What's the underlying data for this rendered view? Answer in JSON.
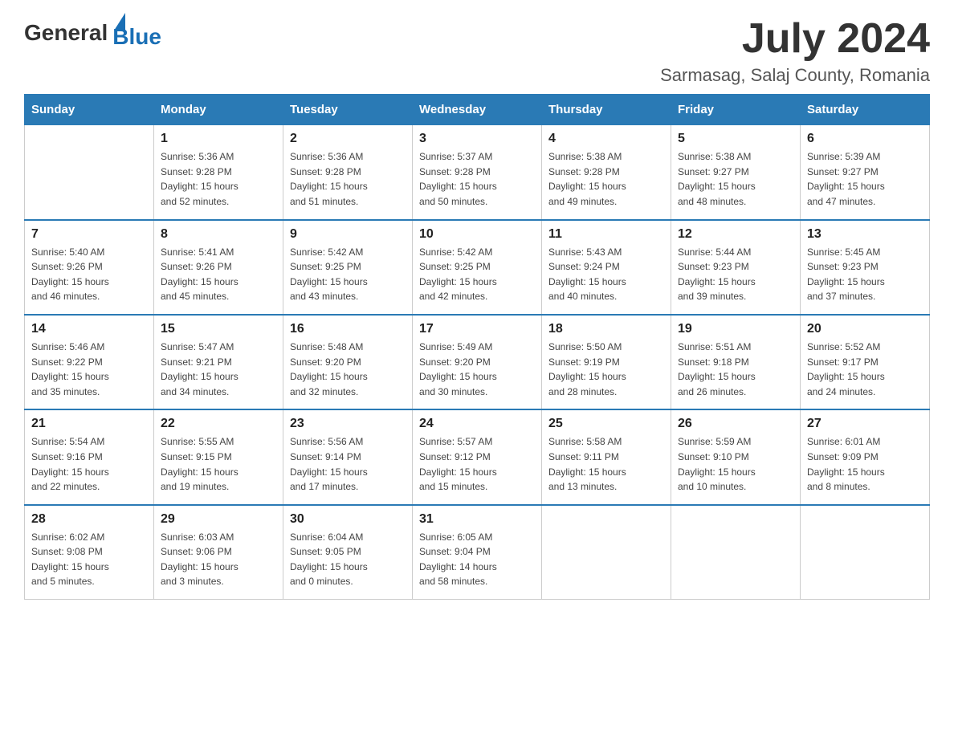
{
  "header": {
    "logo": {
      "text_general": "General",
      "text_blue": "Blue"
    },
    "month_title": "July 2024",
    "location": "Sarmasag, Salaj County, Romania"
  },
  "calendar": {
    "days_of_week": [
      "Sunday",
      "Monday",
      "Tuesday",
      "Wednesday",
      "Thursday",
      "Friday",
      "Saturday"
    ],
    "weeks": [
      [
        {
          "day": "",
          "info": ""
        },
        {
          "day": "1",
          "info": "Sunrise: 5:36 AM\nSunset: 9:28 PM\nDaylight: 15 hours\nand 52 minutes."
        },
        {
          "day": "2",
          "info": "Sunrise: 5:36 AM\nSunset: 9:28 PM\nDaylight: 15 hours\nand 51 minutes."
        },
        {
          "day": "3",
          "info": "Sunrise: 5:37 AM\nSunset: 9:28 PM\nDaylight: 15 hours\nand 50 minutes."
        },
        {
          "day": "4",
          "info": "Sunrise: 5:38 AM\nSunset: 9:28 PM\nDaylight: 15 hours\nand 49 minutes."
        },
        {
          "day": "5",
          "info": "Sunrise: 5:38 AM\nSunset: 9:27 PM\nDaylight: 15 hours\nand 48 minutes."
        },
        {
          "day": "6",
          "info": "Sunrise: 5:39 AM\nSunset: 9:27 PM\nDaylight: 15 hours\nand 47 minutes."
        }
      ],
      [
        {
          "day": "7",
          "info": "Sunrise: 5:40 AM\nSunset: 9:26 PM\nDaylight: 15 hours\nand 46 minutes."
        },
        {
          "day": "8",
          "info": "Sunrise: 5:41 AM\nSunset: 9:26 PM\nDaylight: 15 hours\nand 45 minutes."
        },
        {
          "day": "9",
          "info": "Sunrise: 5:42 AM\nSunset: 9:25 PM\nDaylight: 15 hours\nand 43 minutes."
        },
        {
          "day": "10",
          "info": "Sunrise: 5:42 AM\nSunset: 9:25 PM\nDaylight: 15 hours\nand 42 minutes."
        },
        {
          "day": "11",
          "info": "Sunrise: 5:43 AM\nSunset: 9:24 PM\nDaylight: 15 hours\nand 40 minutes."
        },
        {
          "day": "12",
          "info": "Sunrise: 5:44 AM\nSunset: 9:23 PM\nDaylight: 15 hours\nand 39 minutes."
        },
        {
          "day": "13",
          "info": "Sunrise: 5:45 AM\nSunset: 9:23 PM\nDaylight: 15 hours\nand 37 minutes."
        }
      ],
      [
        {
          "day": "14",
          "info": "Sunrise: 5:46 AM\nSunset: 9:22 PM\nDaylight: 15 hours\nand 35 minutes."
        },
        {
          "day": "15",
          "info": "Sunrise: 5:47 AM\nSunset: 9:21 PM\nDaylight: 15 hours\nand 34 minutes."
        },
        {
          "day": "16",
          "info": "Sunrise: 5:48 AM\nSunset: 9:20 PM\nDaylight: 15 hours\nand 32 minutes."
        },
        {
          "day": "17",
          "info": "Sunrise: 5:49 AM\nSunset: 9:20 PM\nDaylight: 15 hours\nand 30 minutes."
        },
        {
          "day": "18",
          "info": "Sunrise: 5:50 AM\nSunset: 9:19 PM\nDaylight: 15 hours\nand 28 minutes."
        },
        {
          "day": "19",
          "info": "Sunrise: 5:51 AM\nSunset: 9:18 PM\nDaylight: 15 hours\nand 26 minutes."
        },
        {
          "day": "20",
          "info": "Sunrise: 5:52 AM\nSunset: 9:17 PM\nDaylight: 15 hours\nand 24 minutes."
        }
      ],
      [
        {
          "day": "21",
          "info": "Sunrise: 5:54 AM\nSunset: 9:16 PM\nDaylight: 15 hours\nand 22 minutes."
        },
        {
          "day": "22",
          "info": "Sunrise: 5:55 AM\nSunset: 9:15 PM\nDaylight: 15 hours\nand 19 minutes."
        },
        {
          "day": "23",
          "info": "Sunrise: 5:56 AM\nSunset: 9:14 PM\nDaylight: 15 hours\nand 17 minutes."
        },
        {
          "day": "24",
          "info": "Sunrise: 5:57 AM\nSunset: 9:12 PM\nDaylight: 15 hours\nand 15 minutes."
        },
        {
          "day": "25",
          "info": "Sunrise: 5:58 AM\nSunset: 9:11 PM\nDaylight: 15 hours\nand 13 minutes."
        },
        {
          "day": "26",
          "info": "Sunrise: 5:59 AM\nSunset: 9:10 PM\nDaylight: 15 hours\nand 10 minutes."
        },
        {
          "day": "27",
          "info": "Sunrise: 6:01 AM\nSunset: 9:09 PM\nDaylight: 15 hours\nand 8 minutes."
        }
      ],
      [
        {
          "day": "28",
          "info": "Sunrise: 6:02 AM\nSunset: 9:08 PM\nDaylight: 15 hours\nand 5 minutes."
        },
        {
          "day": "29",
          "info": "Sunrise: 6:03 AM\nSunset: 9:06 PM\nDaylight: 15 hours\nand 3 minutes."
        },
        {
          "day": "30",
          "info": "Sunrise: 6:04 AM\nSunset: 9:05 PM\nDaylight: 15 hours\nand 0 minutes."
        },
        {
          "day": "31",
          "info": "Sunrise: 6:05 AM\nSunset: 9:04 PM\nDaylight: 14 hours\nand 58 minutes."
        },
        {
          "day": "",
          "info": ""
        },
        {
          "day": "",
          "info": ""
        },
        {
          "day": "",
          "info": ""
        }
      ]
    ]
  }
}
